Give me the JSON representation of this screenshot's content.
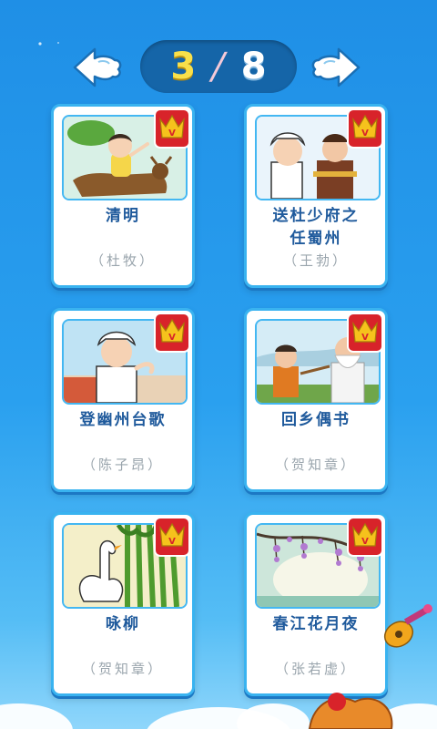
{
  "pager": {
    "current": "3",
    "separator": "/",
    "total": "8"
  },
  "icons": {
    "prev": "cloud-arrow-left-icon",
    "next": "cloud-arrow-right-icon",
    "premium": "crown-v-icon"
  },
  "poems": [
    {
      "title_lines": [
        "清明",
        ""
      ],
      "author": "（杜牧）",
      "premium": true
    },
    {
      "title_lines": [
        "送杜少府之",
        "任蜀州"
      ],
      "author": "（王勃）",
      "premium": true
    },
    {
      "title_lines": [
        "登幽州台歌",
        ""
      ],
      "author": "（陈子昂）",
      "premium": true
    },
    {
      "title_lines": [
        "回乡偶书",
        ""
      ],
      "author": "（贺知章）",
      "premium": true
    },
    {
      "title_lines": [
        "咏柳",
        ""
      ],
      "author": "（贺知章）",
      "premium": true
    },
    {
      "title_lines": [
        "春江花月夜",
        ""
      ],
      "author": "（张若虚）",
      "premium": true
    }
  ],
  "colors": {
    "background_top": "#1f8fe6",
    "card_border": "#39b3f0",
    "title_text": "#1f5a9c",
    "author_text": "#9aa5ad",
    "pager_current": "#f9e04a",
    "badge_red": "#d8232a",
    "crown_gold": "#f6c21c"
  }
}
